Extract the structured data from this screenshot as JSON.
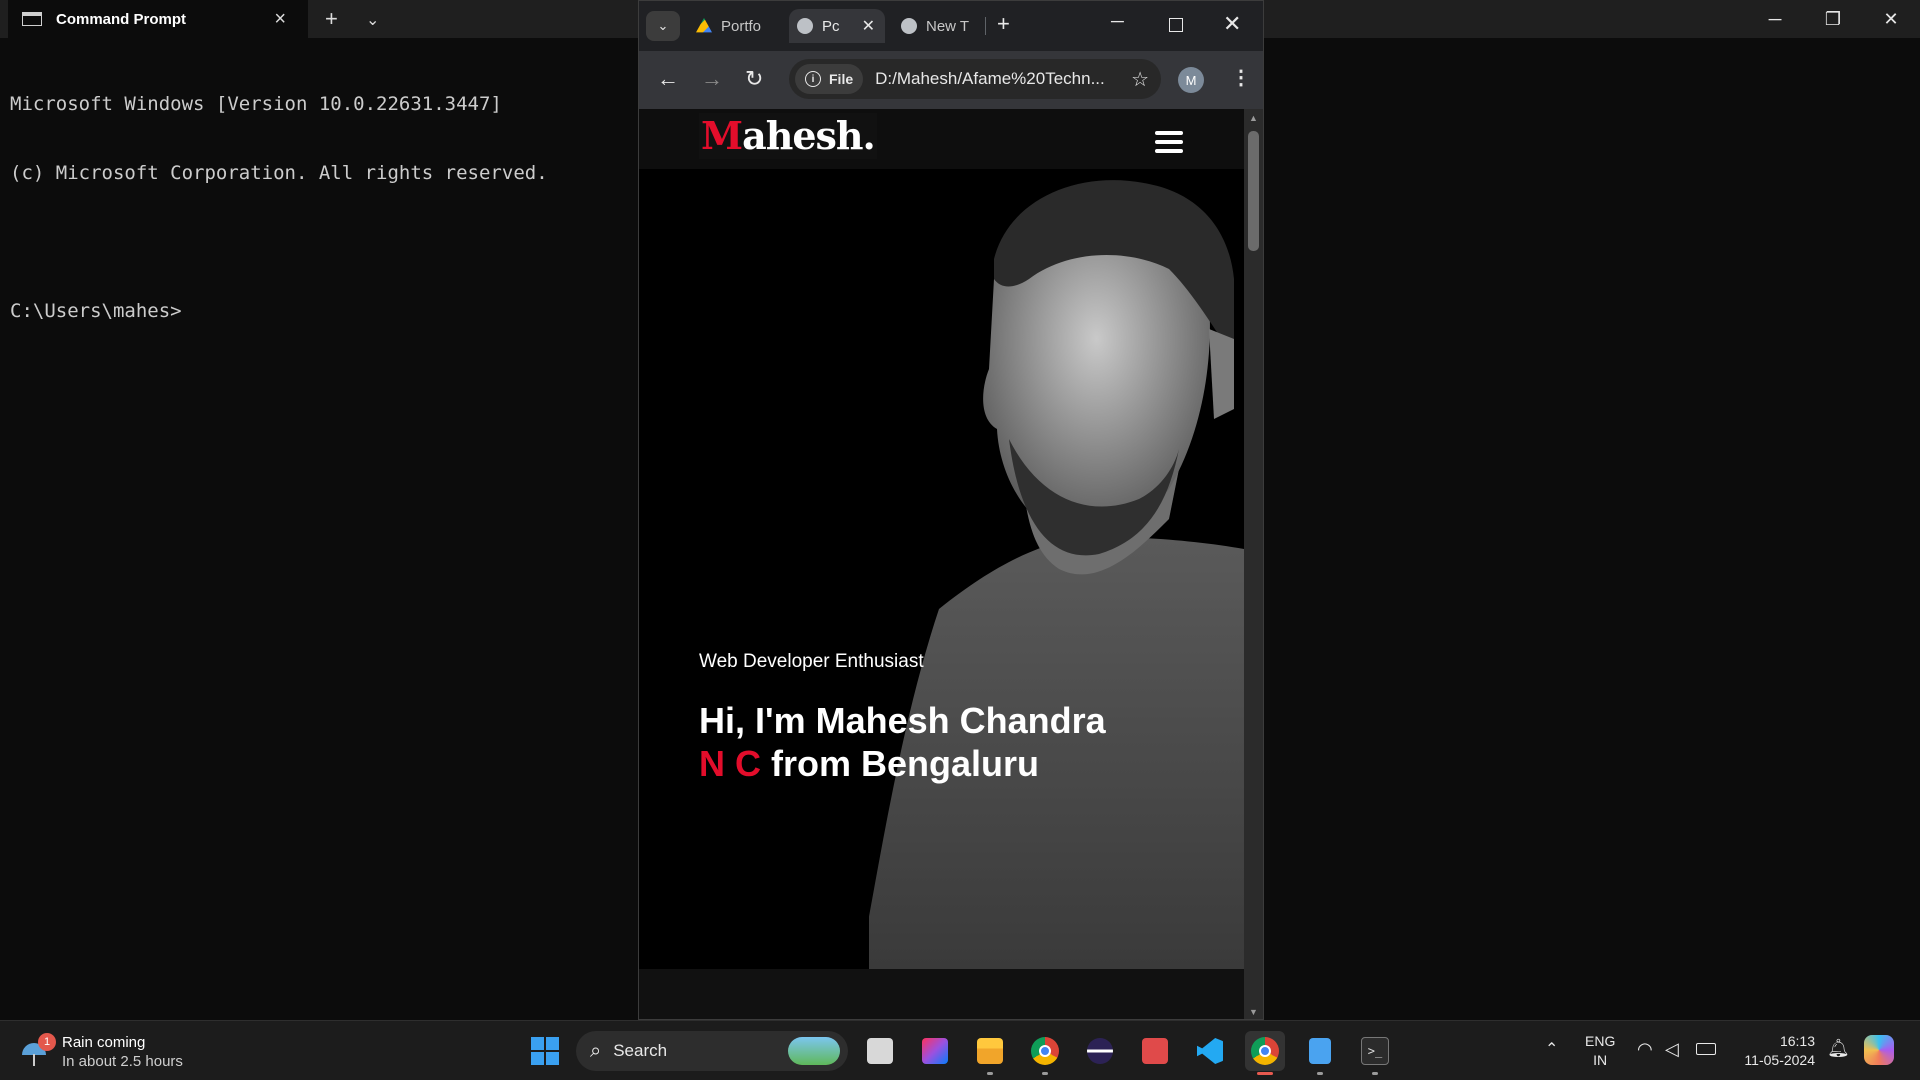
{
  "terminal": {
    "tab_title": "Command Prompt",
    "lines": [
      "Microsoft Windows [Version 10.0.22631.3447]",
      "(c) Microsoft Corporation. All rights reserved.",
      "",
      "C:\\Users\\mahes>"
    ]
  },
  "browser": {
    "tabs": [
      {
        "label": "Portfo"
      },
      {
        "label": "Pc"
      },
      {
        "label": "New T"
      }
    ],
    "site_chip": "File",
    "url": "D:/Mahesh/Afame%20Techn...",
    "profile_initial": "M"
  },
  "site": {
    "logo_first": "M",
    "logo_rest": "ahesh.",
    "hero_tagline": "Web Developer Enthusiast",
    "hero_title_line1": "Hi, I'm Mahesh Chandra",
    "hero_highlight": "N C",
    "hero_title_rest": " from Bengaluru",
    "accent_color": "#e30d2b"
  },
  "taskbar": {
    "weather_badge": "1",
    "weather_title": "Rain coming",
    "weather_sub": "In about 2.5 hours",
    "search_label": "Search",
    "lang_line1": "ENG",
    "lang_line2": "IN",
    "time": "16:13",
    "date": "11-05-2024"
  }
}
